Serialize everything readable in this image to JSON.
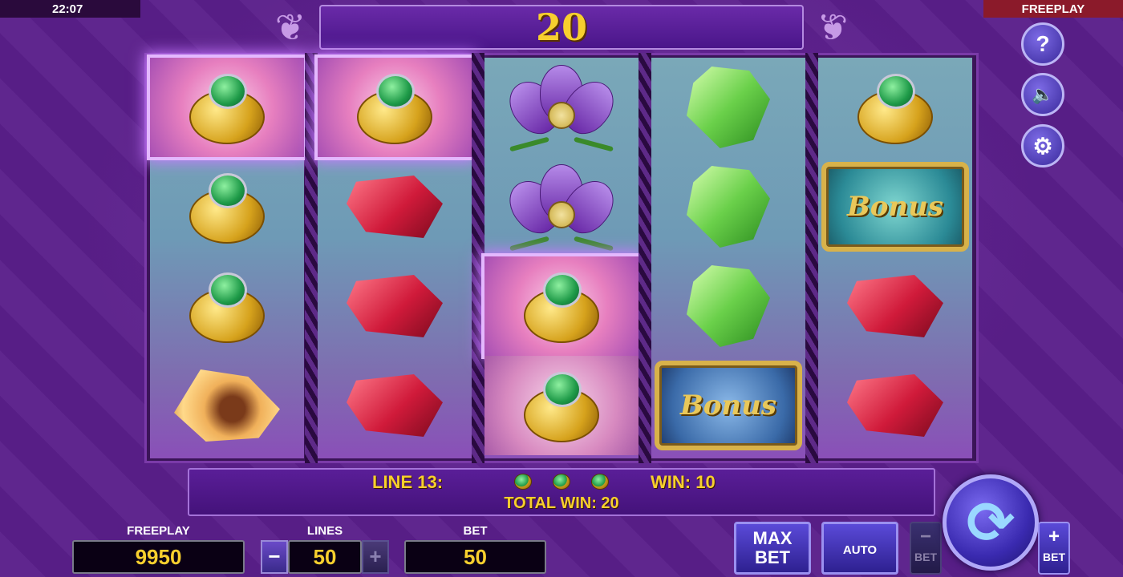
{
  "status": {
    "clock": "22:07",
    "mode": "FREEPLAY"
  },
  "banner": {
    "win_amount": "20"
  },
  "side_buttons": {
    "help": "?",
    "sound": "🔈",
    "settings": "⚙"
  },
  "reels": [
    [
      "ring",
      "ring",
      "ring",
      "topaz"
    ],
    [
      "ring",
      "ruby",
      "ruby",
      "ruby"
    ],
    [
      "flower",
      "flower",
      "ring",
      "ring"
    ],
    [
      "emerald",
      "emerald",
      "emerald",
      "bonus"
    ],
    [
      "ring",
      "bonus",
      "ruby",
      "ruby"
    ]
  ],
  "bonus_label": "Bonus",
  "win_info": {
    "line_label": "LINE 13:",
    "win_label": "WIN: 10",
    "total_label": "TOTAL WIN: 20"
  },
  "controls": {
    "freeplay_label": "FREEPLAY",
    "freeplay_value": "9950",
    "lines_label": "LINES",
    "lines_value": "50",
    "bet_label": "BET",
    "bet_value": "50",
    "minus": "−",
    "plus": "+",
    "max_bet_line1": "MAX",
    "max_bet_line2": "BET",
    "auto_label": "AUTO",
    "bet_minus_label": "BET",
    "bet_plus_label": "BET"
  }
}
